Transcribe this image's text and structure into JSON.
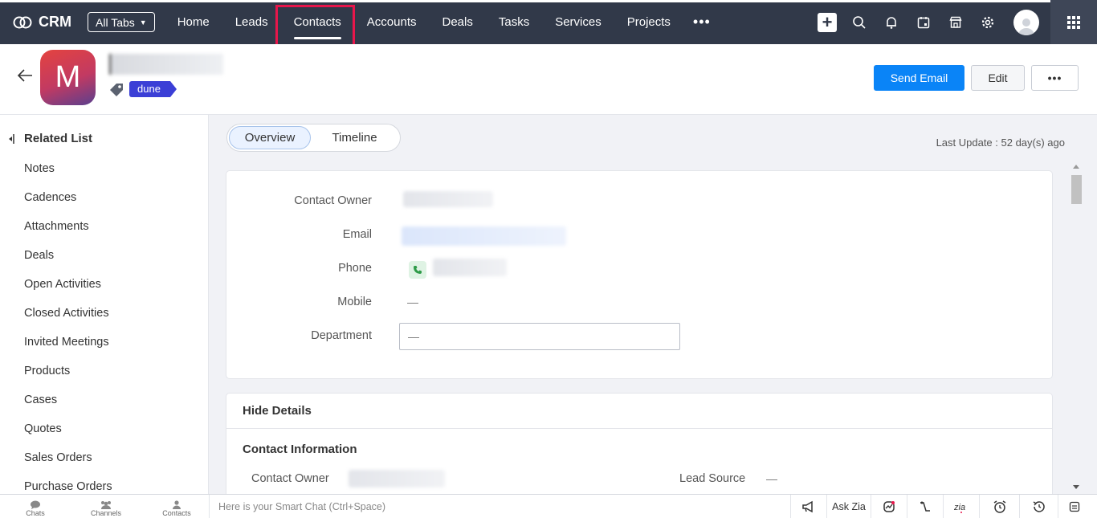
{
  "nav": {
    "brand": "CRM",
    "all_tabs": "All Tabs",
    "tabs": [
      {
        "label": "Home"
      },
      {
        "label": "Leads"
      },
      {
        "label": "Contacts",
        "active": true
      },
      {
        "label": "Accounts"
      },
      {
        "label": "Deals"
      },
      {
        "label": "Tasks"
      },
      {
        "label": "Services"
      },
      {
        "label": "Projects"
      }
    ],
    "more": "•••",
    "right_icons": [
      "plus-icon",
      "search-icon",
      "bell-icon",
      "calendar-icon",
      "marketplace-icon",
      "gear-icon",
      "user-avatar",
      "apps-grid-icon"
    ],
    "highlight_color": "#e8164b"
  },
  "header": {
    "avatar_letter": "M",
    "tag": "dune",
    "send_email": "Send Email",
    "edit": "Edit",
    "more": "•••"
  },
  "sidebar": {
    "title": "Related List",
    "items": [
      "Notes",
      "Cadences",
      "Attachments",
      "Deals",
      "Open Activities",
      "Closed Activities",
      "Invited Meetings",
      "Products",
      "Cases",
      "Quotes",
      "Sales Orders",
      "Purchase Orders"
    ]
  },
  "main": {
    "segments": {
      "overview": "Overview",
      "timeline": "Timeline"
    },
    "last_update": "Last Update : 52 day(s) ago",
    "overview_fields": {
      "contact_owner": "Contact Owner",
      "email": "Email",
      "phone": "Phone",
      "mobile": "Mobile",
      "mobile_value": "—",
      "department": "Department",
      "department_value": "—"
    },
    "details": {
      "hide_details": "Hide Details",
      "section_title": "Contact Information",
      "contact_owner": "Contact Owner",
      "lead_source": "Lead Source",
      "lead_source_value": "—"
    }
  },
  "bottom": {
    "left": [
      {
        "label": "Chats",
        "icon": "chat-icon"
      },
      {
        "label": "Channels",
        "icon": "channels-icon"
      },
      {
        "label": "Contacts",
        "icon": "contacts-icon"
      }
    ],
    "smart_chat": "Here is your Smart Chat (Ctrl+Space)",
    "ask_zia": "Ask Zia"
  },
  "colors": {
    "nav_bg": "#313949",
    "primary": "#0a84f7",
    "tag": "#3b3fd6"
  }
}
